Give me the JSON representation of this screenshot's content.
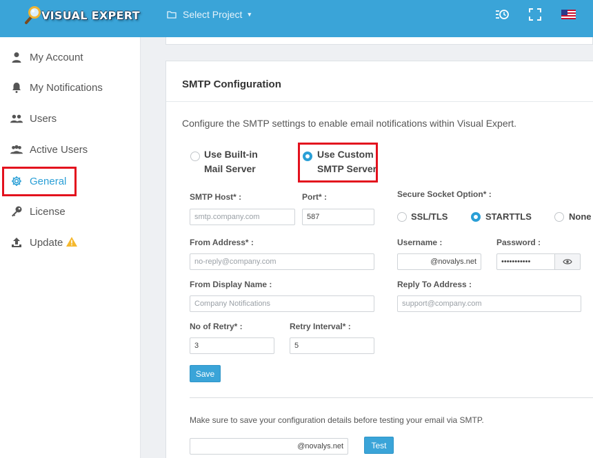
{
  "header": {
    "logo_text": "VISUAL EXPERT",
    "project_select": "Select Project",
    "icons": [
      "history-icon",
      "fullscreen-icon",
      "us-flag-icon"
    ],
    "accent": "#3aa4d8"
  },
  "sidebar": {
    "items": [
      {
        "label": "My Account",
        "icon": "user-icon"
      },
      {
        "label": "My Notifications",
        "icon": "bell-icon"
      },
      {
        "label": "Users",
        "icon": "users-icon"
      },
      {
        "label": "Active Users",
        "icon": "active-users-icon"
      },
      {
        "label": "General",
        "icon": "gear-icon",
        "active": true
      },
      {
        "label": "License",
        "icon": "key-icon"
      },
      {
        "label": "Update",
        "icon": "upload-icon",
        "badge": "warning-icon"
      }
    ]
  },
  "smtp": {
    "title": "SMTP Configuration",
    "description": "Configure the SMTP settings to enable email notifications within Visual Expert.",
    "mail_server": {
      "builtin_line1": "Use Built-in",
      "builtin_line2": "Mail Server",
      "custom_line1": "Use Custom",
      "custom_line2": "SMTP Server",
      "selected": "custom"
    },
    "host": {
      "label": "SMTP Host* :",
      "placeholder": "smtp.company.com"
    },
    "port": {
      "label": "Port* :",
      "value": "587"
    },
    "secure": {
      "label": "Secure Socket Option* :",
      "options": [
        "SSL/TLS",
        "STARTTLS",
        "None"
      ],
      "selected": "STARTTLS"
    },
    "from_address": {
      "label": "From Address* :",
      "placeholder": "no-reply@company.com"
    },
    "username": {
      "label": "Username :",
      "value": "@novalys.net"
    },
    "password": {
      "label": "Password :",
      "value": "•••••••••••"
    },
    "display_name": {
      "label": "From Display Name :",
      "placeholder": "Company Notifications"
    },
    "reply_to": {
      "label": "Reply To Address :",
      "placeholder": "support@company.com"
    },
    "retry": {
      "label": "No of Retry* :",
      "value": "3"
    },
    "retry_interval": {
      "label": "Retry Interval* :",
      "value": "5"
    },
    "save_label": "Save",
    "test_note": "Make sure to save your configuration details before testing your email via SMTP.",
    "test_email": "@novalys.net",
    "test_label": "Test"
  }
}
